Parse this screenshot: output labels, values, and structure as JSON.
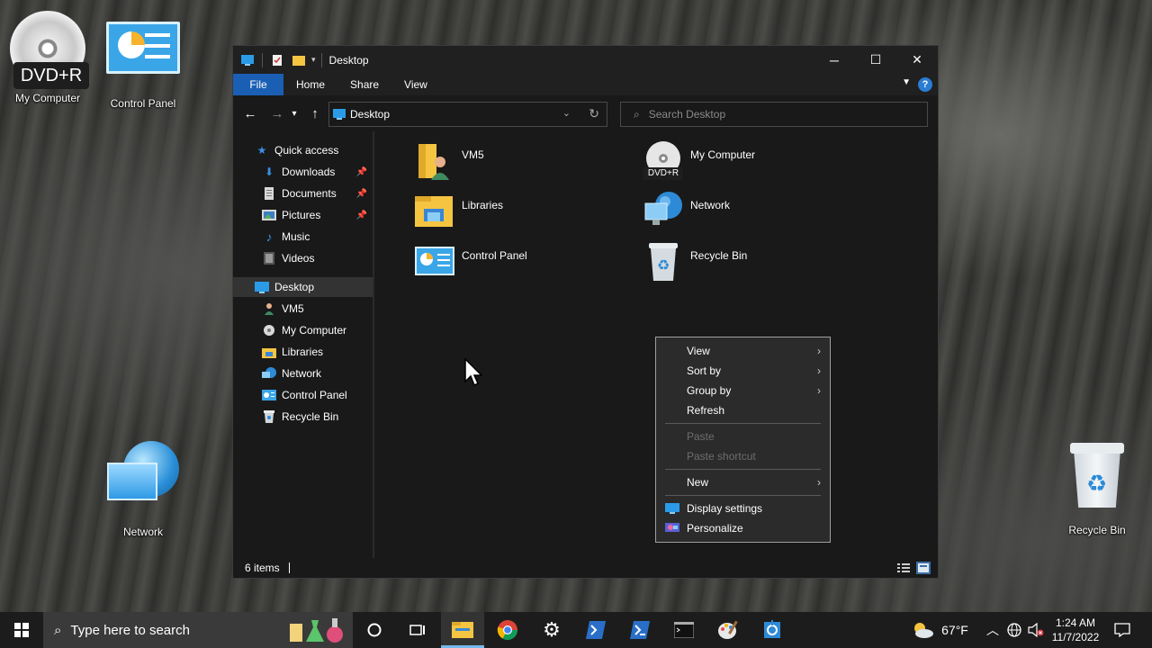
{
  "desktop": {
    "icons": [
      {
        "label": "My Computer",
        "badge": "DVD+R"
      },
      {
        "label": "Control Panel"
      },
      {
        "label": "Network"
      },
      {
        "label": "Recycle Bin"
      }
    ]
  },
  "window": {
    "title": "Desktop",
    "controls": {
      "minimize": "─",
      "maximize": "☐",
      "close": "✕"
    },
    "ribbon_tabs": [
      "File",
      "Home",
      "Share",
      "View"
    ],
    "help": "?",
    "address": "Desktop",
    "search_placeholder": "Search Desktop",
    "nav_quick": [
      {
        "label": "Quick access",
        "icon": "star-icon"
      },
      {
        "label": "Downloads",
        "icon": "download-icon",
        "pinned": true
      },
      {
        "label": "Documents",
        "icon": "document-icon",
        "pinned": true
      },
      {
        "label": "Pictures",
        "icon": "picture-icon",
        "pinned": true
      },
      {
        "label": "Music",
        "icon": "music-icon"
      },
      {
        "label": "Videos",
        "icon": "video-icon"
      }
    ],
    "nav_tree": [
      {
        "label": "Desktop",
        "icon": "desktop-icon",
        "selected": true
      },
      {
        "label": "VM5",
        "icon": "user-icon"
      },
      {
        "label": "My Computer",
        "icon": "disc-icon"
      },
      {
        "label": "Libraries",
        "icon": "folder-icon"
      },
      {
        "label": "Network",
        "icon": "network-icon"
      },
      {
        "label": "Control Panel",
        "icon": "control-panel-icon"
      },
      {
        "label": "Recycle Bin",
        "icon": "recycle-bin-icon"
      }
    ],
    "items": [
      {
        "name": "VM5",
        "icon": "user-folder-icon"
      },
      {
        "name": "My Computer",
        "icon": "dvd-icon",
        "badge": "DVD+R"
      },
      {
        "name": "Libraries",
        "icon": "libraries-icon"
      },
      {
        "name": "Network",
        "icon": "network-icon"
      },
      {
        "name": "Control Panel",
        "icon": "control-panel-icon"
      },
      {
        "name": "Recycle Bin",
        "icon": "recycle-bin-icon"
      }
    ],
    "status": "6 items"
  },
  "context_menu": {
    "items": [
      {
        "label": "View",
        "submenu": true,
        "disabled": false
      },
      {
        "label": "Sort by",
        "submenu": true,
        "disabled": false
      },
      {
        "label": "Group by",
        "submenu": true,
        "disabled": false
      },
      {
        "label": "Refresh",
        "submenu": false,
        "disabled": false
      },
      {
        "label": "Paste",
        "submenu": false,
        "disabled": true
      },
      {
        "label": "Paste shortcut",
        "submenu": false,
        "disabled": true
      },
      {
        "label": "New",
        "submenu": true,
        "disabled": false
      },
      {
        "label": "Display settings",
        "submenu": false,
        "disabled": false,
        "icon": "display-icon"
      },
      {
        "label": "Personalize",
        "submenu": false,
        "disabled": false,
        "icon": "personalize-icon"
      }
    ]
  },
  "taskbar": {
    "search_placeholder": "Type here to search",
    "weather": "67°F",
    "time": "1:24 AM",
    "date": "11/7/2022"
  },
  "colors": {
    "accent": "#1a5fb4",
    "window_bg": "#191919",
    "menu_bg": "#2b2b2b"
  }
}
